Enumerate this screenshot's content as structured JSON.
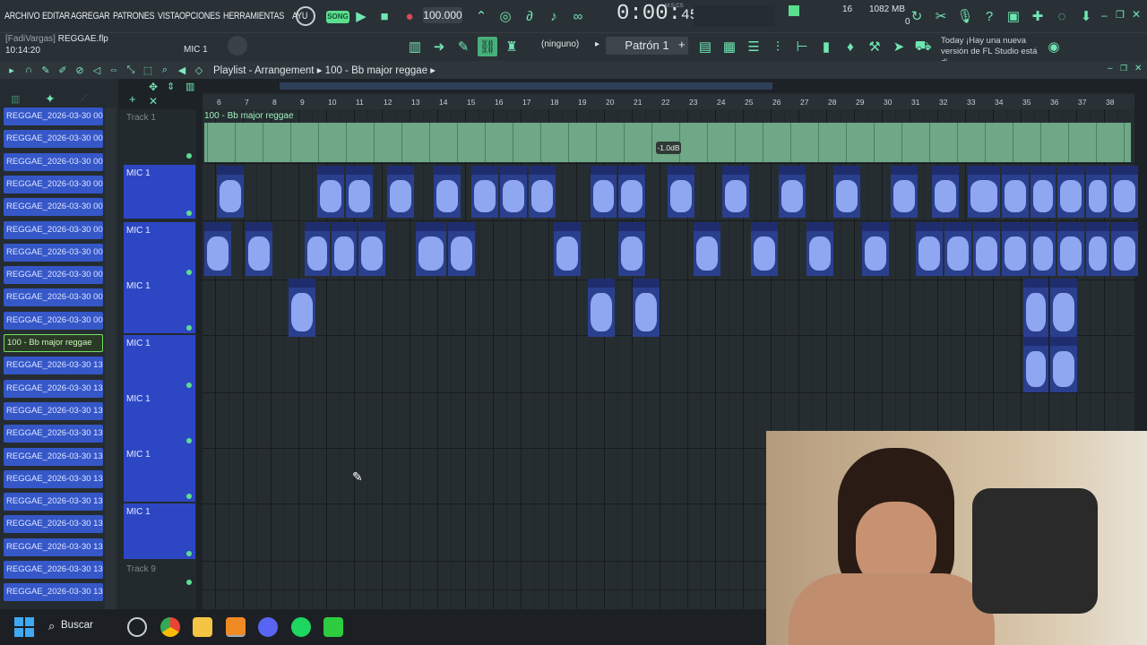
{
  "menu": [
    "ARCHIVO",
    "EDITAR",
    "AGREGAR",
    "PATRONES",
    "VISTA",
    "OPCIONES",
    "HERRAMIENTAS",
    "AYU"
  ],
  "transport": {
    "mode": "SONG",
    "tempo": "100.000",
    "time_main": "0:00",
    "time_sec": "45",
    "time_label": "M:S:CS",
    "cpu": "16",
    "memory": "1082 MB",
    "voices": "0"
  },
  "project": {
    "user": "[FadiVargas]",
    "file": "REGGAE.flp",
    "clock": "10:14:20",
    "mic": "MIC 1"
  },
  "toolbar": {
    "channel": "(ninguno)",
    "pattern": "Patrón 1",
    "news_title": "Today ¡Hay una nueva",
    "news_body": "versión de FL Studio está di..."
  },
  "playlist": {
    "breadcrumb_a": "Playlist - Arrangement",
    "breadcrumb_b": "100 - Bb major reggae",
    "audio_clip": "100 - Bb major reggae",
    "audio_gain": "-1.0dB"
  },
  "ruler": [
    "6",
    "7",
    "8",
    "9",
    "10",
    "11",
    "12",
    "13",
    "14",
    "15",
    "16",
    "17",
    "18",
    "19",
    "20",
    "21",
    "22",
    "23",
    "24",
    "25",
    "26",
    "27",
    "28",
    "29",
    "30",
    "31",
    "32",
    "33",
    "34",
    "35",
    "36",
    "37",
    "38"
  ],
  "patterns": [
    "REGGAE_2026-03-30 00-...",
    "REGGAE_2026-03-30 00-...",
    "REGGAE_2026-03-30 00-...",
    "REGGAE_2026-03-30 00-...",
    "REGGAE_2026-03-30 00-...",
    "REGGAE_2026-03-30 00-...",
    "REGGAE_2026-03-30 00-...",
    "REGGAE_2026-03-30 00-...",
    "REGGAE_2026-03-30 00-...",
    "REGGAE_2026-03-30 00-...",
    "100 - Bb major reggae",
    "REGGAE_2026-03-30 13-...",
    "REGGAE_2026-03-30 13-...",
    "REGGAE_2026-03-30 13-...",
    "REGGAE_2026-03-30 13-...",
    "REGGAE_2026-03-30 13-...",
    "REGGAE_2026-03-30 13-...",
    "REGGAE_2026-03-30 13-...",
    "REGGAE_2026-03-30 13-...",
    "REGGAE_2026-03-30 13-...",
    "REGGAE_2026-03-30 13-...",
    "REGGAE_2026-03-30 13-..."
  ],
  "tracks": [
    "Track 1",
    "MIC 1",
    "MIC 1",
    "MIC 1",
    "MIC 1",
    "MIC 1",
    "MIC 1",
    "MIC 1",
    "Track 9"
  ],
  "taskbar": {
    "search": "Buscar"
  }
}
